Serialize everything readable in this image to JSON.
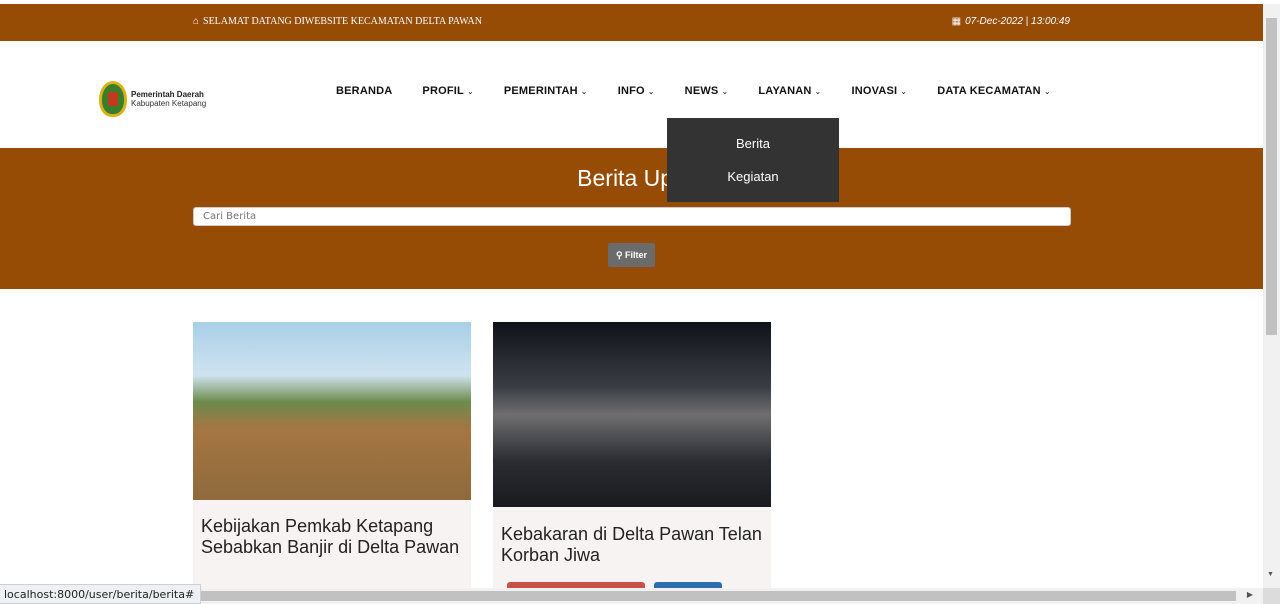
{
  "topbar": {
    "welcome_icon": "home-icon",
    "welcome_text": "SELAMAT DATANG DIWEBSITE KECAMATAN DELTA PAWAN",
    "clock_icon": "calendar-icon",
    "clock_text": "07-Dec-2022 | 13:00:49"
  },
  "logo": {
    "line1": "Pemerintah Daerah",
    "line2": "Kabupaten Ketapang"
  },
  "nav": {
    "items": [
      {
        "label": "BERANDA",
        "chevron": ""
      },
      {
        "label": "PROFIL",
        "chevron": "⌄"
      },
      {
        "label": "PEMERINTAH",
        "chevron": "⌄"
      },
      {
        "label": "INFO",
        "chevron": "⌄"
      },
      {
        "label": "NEWS",
        "chevron": "⌄"
      },
      {
        "label": "LAYANAN",
        "chevron": "⌄"
      },
      {
        "label": "INOVASI",
        "chevron": "⌄"
      },
      {
        "label": "DATA KECAMATAN",
        "chevron": "⌄"
      }
    ]
  },
  "news_dropdown": {
    "items": [
      "Berita",
      "Kegiatan"
    ]
  },
  "hero": {
    "title": "Berita Upd",
    "search_placeholder": "Cari Berita",
    "filter_label": "Filter",
    "filter_icon": "search-icon"
  },
  "cards": [
    {
      "headline": "Kebijakan Pemkab Ketapang Sebabkan Banjir di Delta Pawan"
    },
    {
      "headline": "Kebakaran di Delta Pawan Telan Korban Jiwa"
    }
  ],
  "status_bar": {
    "url": "localhost:8000/user/berita/berita#"
  }
}
